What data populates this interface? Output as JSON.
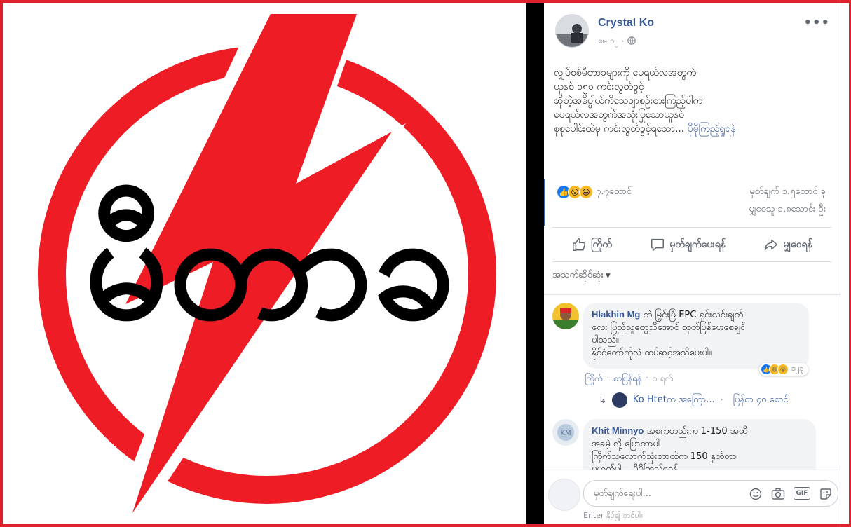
{
  "photo": {
    "logo_text": "မီတာခ",
    "colors": {
      "brand_red": "#ee1c25",
      "ink": "#000000"
    }
  },
  "post": {
    "author": "Crystal Ko",
    "date": "မေ ၁၂",
    "privacy_icon": "globe-icon",
    "more_label": "•••",
    "text_lines": [
      "လျှပ်စစ်မီတာခများကို ပေရယ်လအတွက်",
      "ယူနစ် ၁၅၀ ကင်းလွတ်ခွင့်",
      "ဆိုတဲ့အဓိပ္ပါယ်ကိုသေချာစဥ်းစားကြည့်ပါက",
      "ပေရယ်လအတွက်အသုံးပြုသောယူနစ်",
      "စုစုပေါင်းထဲမှ ကင်းလွတ်ခွင့်ရသော..."
    ],
    "see_more": "ပိုမိုကြည့်ရှုရန်",
    "reaction_count": "၇.၇ထောင်",
    "comments_count": "မှတ်ချက် ၁.၅ထောင် ခု",
    "shares_count": "မျှဝေသူ ၁.၈သောင်း ဦး",
    "actions": {
      "like": "ကြိုက်",
      "comment": "မှတ်ချက်ပေးရန်",
      "share": "မျှဝေရန်"
    },
    "sort_label": "အသက်ဆိုင်ဆုံး"
  },
  "comments": [
    {
      "name": "Hlakhin Mg",
      "lines": [
        "ကဲ မြှင်းဖြံ EPC ရှင်းလင်းချက်",
        "လေး ပြည်သူတွေသိအောင် ထုတ်ပြန်ပေးစေချင်",
        "ပါသည်။",
        "နိုင်ငံတော်ကိုလဲ ထပ်ဆင့်အသိပေးပါ။"
      ],
      "like": "ကြိုက်",
      "reply": "စာပြန်ရန်",
      "time": "၁ ရက်",
      "reaction_count": "၁၂၃"
    },
    {
      "name": "Khit Minnyo",
      "lines": [
        "အစကတည်းက 1-150 အထိ",
        "အခမဲ့ လို့ ပြောတာပါ",
        "ကြိုက်သလောက်သုံးတာထဲက 150 နှုတ်တာ",
        "မဟုတ်ပါ... ပိုမိုကြည့်ရှုရန်"
      ]
    }
  ],
  "reply_thread": {
    "name": "Ko Htetက အကြော...",
    "count": "ပြန်စာ ၄၀ စောင်"
  },
  "composer": {
    "placeholder": "မှတ်ချက်ရေးပါ...",
    "hint": "Enter နှိပ်၍ တင်ပါ။",
    "gif_label": "GIF"
  }
}
